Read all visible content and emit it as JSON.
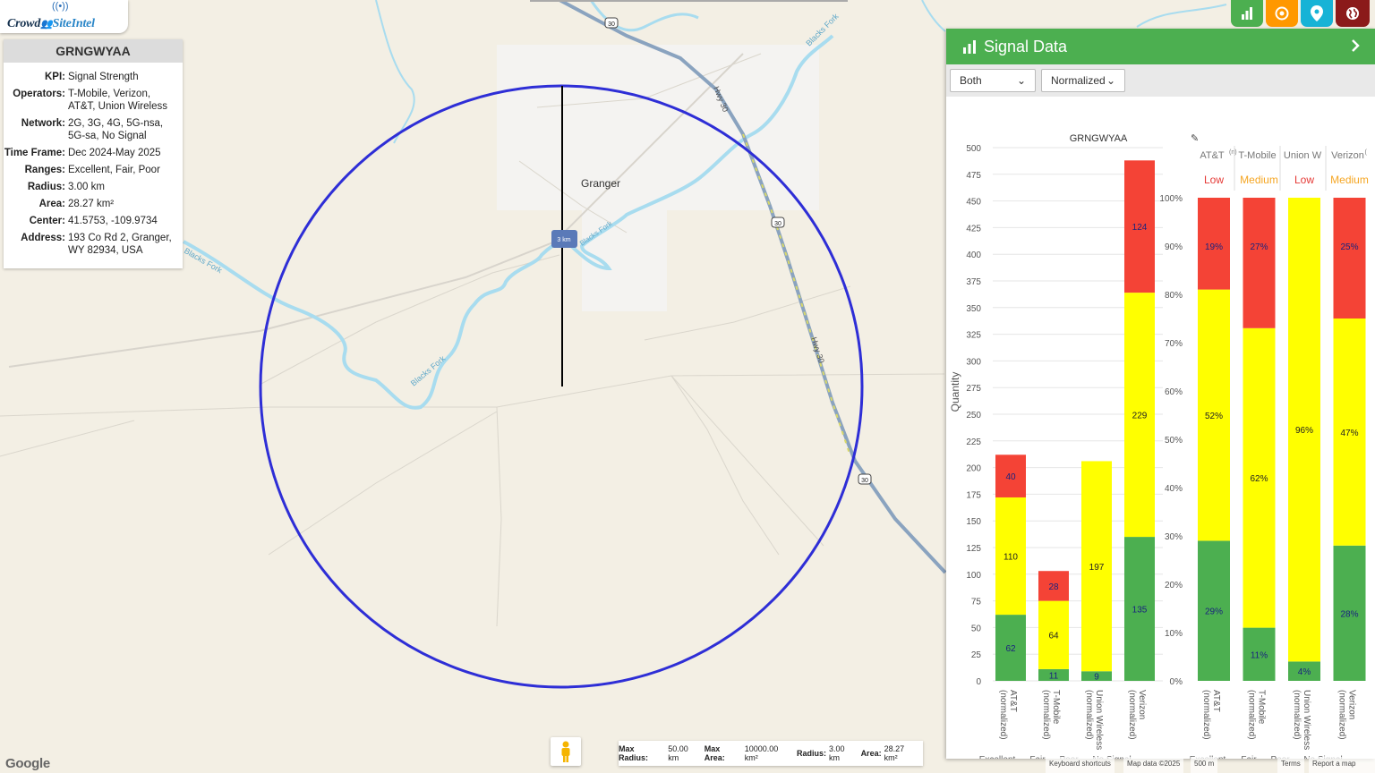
{
  "app": {
    "brand_part1": "Crowd",
    "brand_part2": "SiteIntel"
  },
  "site_card": {
    "title": "GRNGWYAA",
    "rows": [
      {
        "key": "KPI:",
        "value": "Signal Strength"
      },
      {
        "key": "Operators:",
        "value": "T-Mobile, Verizon, AT&T, Union Wireless"
      },
      {
        "key": "Network:",
        "value": "2G, 3G, 4G, 5G-nsa, 5G-sa, No Signal"
      },
      {
        "key": "Time Frame:",
        "value": "Dec 2024-May 2025"
      },
      {
        "key": "Ranges:",
        "value": "Excellent, Fair, Poor"
      },
      {
        "key": "Radius:",
        "value": "3.00 km"
      },
      {
        "key": "Area:",
        "value": "28.27 km²"
      },
      {
        "key": "Center:",
        "value": "41.5753, -109.9734"
      },
      {
        "key": "Address:",
        "value": "193 Co Rd 2, Granger, WY 82934, USA"
      }
    ]
  },
  "toolbar": {
    "buttons": [
      {
        "name": "chart",
        "color": "#4caf50"
      },
      {
        "name": "target",
        "color": "#ff9800"
      },
      {
        "name": "pin",
        "color": "#17b3d6"
      },
      {
        "name": "globe",
        "color": "#8b1a1a"
      }
    ]
  },
  "map": {
    "town_label": "Granger",
    "radius_label": "3 km",
    "river_labels": [
      "Blacks Fork",
      "Blacks Fork",
      "Blacks Fork",
      "Blacks Fork"
    ],
    "highway_labels": [
      "Hwy 30",
      "Hwy 30"
    ],
    "shields": [
      "30",
      "30",
      "30"
    ],
    "circle_color": "#2e2ed6"
  },
  "panel": {
    "title": "Signal Data",
    "operator_select": "Both",
    "mode_select": "Normalized"
  },
  "chart_data": [
    {
      "type": "bar",
      "stacked": true,
      "title": "GRNGWYAA",
      "ylabel": "Quantity",
      "xlabel": "",
      "ylim": [
        0,
        500
      ],
      "yticks": [
        0,
        25,
        50,
        75,
        100,
        125,
        150,
        175,
        200,
        225,
        250,
        275,
        300,
        325,
        350,
        375,
        400,
        425,
        450,
        475,
        500
      ],
      "categories": [
        "AT&T (normalized)",
        "T-Mobile (normalized)",
        "Union Wireless (normalized)",
        "Verizon (normalized)"
      ],
      "series": [
        {
          "name": "Excellent",
          "color": "#4caf50",
          "values": [
            62,
            11,
            9,
            135
          ]
        },
        {
          "name": "Fair",
          "color": "#ffff00",
          "values": [
            110,
            64,
            197,
            229
          ]
        },
        {
          "name": "Poor",
          "color": "#f44336",
          "values": [
            40,
            28,
            0,
            124
          ]
        },
        {
          "name": "No Signal",
          "color": "#c8c8c8",
          "values": [
            0,
            0,
            0,
            0
          ]
        }
      ],
      "data_labels": [
        {
          "excellent": "62",
          "fair": "110",
          "poor": "40"
        },
        {
          "excellent": "11",
          "fair": "64",
          "poor": "28"
        },
        {
          "excellent": "9",
          "fair": "197",
          "poor": ""
        },
        {
          "excellent": "135",
          "fair": "229",
          "poor": "124"
        }
      ],
      "legend": [
        "Excellent",
        "Fair",
        "Poor",
        "No Signal"
      ],
      "legend_position": "bottom"
    },
    {
      "type": "bar",
      "stacked": true,
      "percent": true,
      "ylim": [
        0,
        100
      ],
      "yticks": [
        "0%",
        "10%",
        "20%",
        "30%",
        "40%",
        "50%",
        "60%",
        "70%",
        "80%",
        "90%",
        "100%"
      ],
      "header_labels": [
        "AT&T",
        "T-Mobile",
        "Union W",
        "Verizon"
      ],
      "header_sup": [
        "(n)",
        "",
        "",
        "("
      ],
      "header_ratings": [
        {
          "text": "Low",
          "color": "#e53935"
        },
        {
          "text": "Medium",
          "color": "#f5a623"
        },
        {
          "text": "Low",
          "color": "#e53935"
        },
        {
          "text": "Medium",
          "color": "#f5a623"
        }
      ],
      "categories": [
        "AT&T (normalized)",
        "T-Mobile (normalized)",
        "Union Wireless (normalized)",
        "Verizon (normalized)"
      ],
      "series": [
        {
          "name": "Excellent",
          "color": "#4caf50",
          "values": [
            29,
            11,
            4,
            28
          ]
        },
        {
          "name": "Fair",
          "color": "#ffff00",
          "values": [
            52,
            62,
            96,
            47
          ]
        },
        {
          "name": "Poor",
          "color": "#f44336",
          "values": [
            19,
            27,
            0,
            25
          ]
        },
        {
          "name": "No Signal",
          "color": "#c8c8c8",
          "values": [
            0,
            0,
            0,
            0
          ]
        }
      ],
      "data_labels": [
        {
          "excellent": "29%",
          "fair": "52%",
          "poor": "19%"
        },
        {
          "excellent": "11%",
          "fair": "62%",
          "poor": "27%"
        },
        {
          "excellent": "4%",
          "fair": "96%",
          "poor": ""
        },
        {
          "excellent": "28%",
          "fair": "47%",
          "poor": "25%"
        }
      ],
      "legend": [
        "Excellent",
        "Fair",
        "Poor",
        "No Signal"
      ],
      "legend_position": "bottom"
    }
  ],
  "footer": {
    "max_radius_label": "Max Radius:",
    "max_radius": "50.00 km",
    "max_area_label": "Max Area:",
    "max_area": "10000.00 km²",
    "radius_label": "Radius:",
    "radius": "3.00 km",
    "area_label": "Area:",
    "area": "28.27 km²",
    "google": "Google",
    "keyboard": "Keyboard shortcuts",
    "map_data": "Map data ©2025",
    "scale": "500 m",
    "terms": "Terms",
    "report": "Report a map error"
  }
}
